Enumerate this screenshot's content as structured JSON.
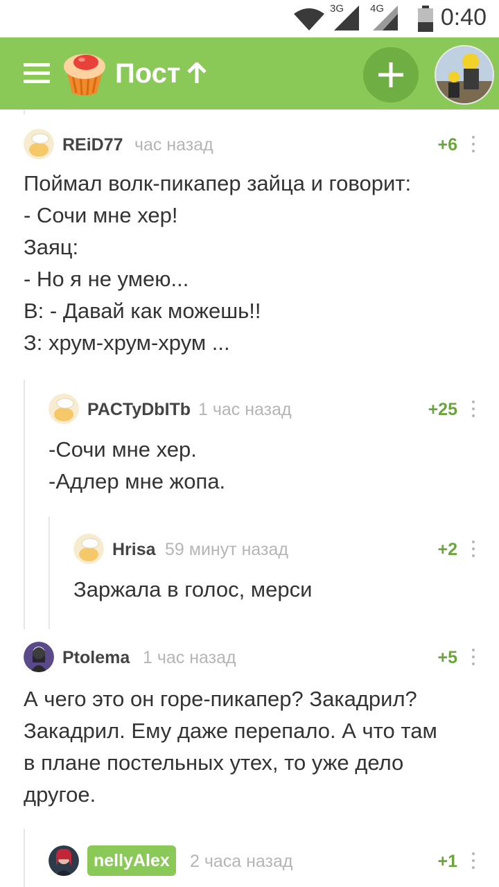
{
  "status_bar": {
    "network_a": "3G",
    "network_b": "4G",
    "time": "0:40"
  },
  "header": {
    "title": "Пост"
  },
  "comments": [
    {
      "author": "REiD77",
      "time": "час назад",
      "score": "+6",
      "lines": [
        "Поймал волк-пикапер зайца и говорит:",
        "- Сочи мне хер!",
        "Заяц:",
        "- Но я не умею...",
        "В: - Давай как можешь!!",
        "З: хрум-хрум-хрум ..."
      ]
    },
    {
      "author": "PACTyDbITb",
      "time": "1 час назад",
      "score": "+25",
      "lines": [
        "-Сочи мне хер.",
        "-Адлер мне жопа."
      ]
    },
    {
      "author": "Hrisa",
      "time": "59 минут назад",
      "score": "+2",
      "lines": [
        "Заржала в голос, мерси"
      ]
    },
    {
      "author": "Ptolema",
      "time": "1 час назад",
      "score": "+5",
      "lines": [
        "А чего это он горе-пикапер? Закадрил?",
        "Закадрил. Ему даже перепало. А что там",
        "в плане постельных утех, то уже дело",
        "другое."
      ]
    },
    {
      "author": "nellyAlex",
      "time": "2 часа назад",
      "score": "+1",
      "lines": []
    }
  ],
  "colors": {
    "accent": "#8ac858",
    "score": "#6aa53e",
    "muted": "#b5b5b5"
  },
  "icons": [
    "menu-icon",
    "cupcake-logo-icon",
    "arrow-up-icon",
    "plus-icon",
    "more-vertical-icon",
    "wifi-icon",
    "signal-icon",
    "battery-icon"
  ]
}
